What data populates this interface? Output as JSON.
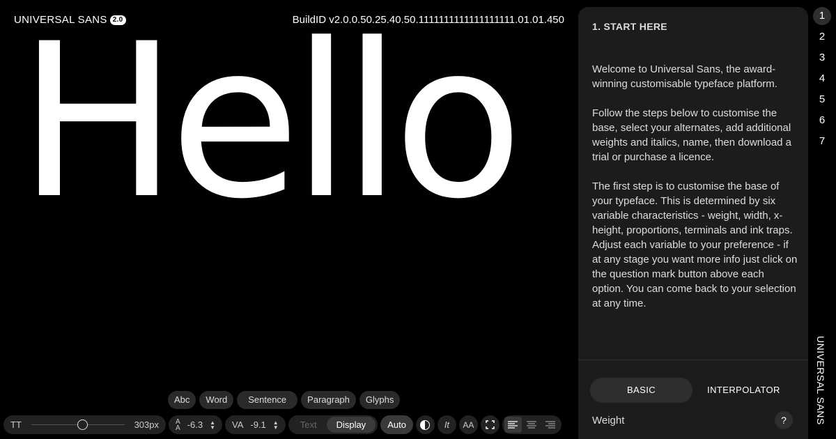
{
  "header": {
    "brand": "UNIVERSAL SANS",
    "version_badge": "2.0",
    "build_id": "BuildID v2.0.0.50.25.40.50.1111111111111111111.01.01.450"
  },
  "preview": {
    "text": "Hello"
  },
  "modes": [
    "Abc",
    "Word",
    "Sentence",
    "Paragraph",
    "Glyphs"
  ],
  "toolbar": {
    "size_label": "TT",
    "size_value": "303px",
    "size_slider_fraction": 0.55,
    "leading_label_top": "A",
    "leading_label_bottom": "A",
    "leading_value": "-6.3",
    "tracking_label": "VA",
    "tracking_value": "-9.1",
    "style_text": "Text",
    "style_display": "Display",
    "auto": "Auto",
    "italic": "It",
    "case": "AA"
  },
  "panel": {
    "title": "1. START HERE",
    "paragraphs": [
      "Welcome to Universal Sans, the award-winning customisable typeface platform.",
      "Follow the steps below to customise the base, select your alternates, add additional weights and italics, name, then download a trial or purchase a licence.",
      "The first step is to customise the base of your typeface. This is determined by six variable characteristics - weight, width, x-height, proportions, terminals and ink traps. Adjust each variable to your preference - if at any stage you want more info just click on the question mark button above each option. You can come back to your selection at any time."
    ],
    "tabs": [
      "BASIC",
      "INTERPOLATOR"
    ],
    "weight_label": "Weight",
    "help": "?"
  },
  "steps": [
    "1",
    "2",
    "3",
    "4",
    "5",
    "6",
    "7"
  ],
  "side_brand": "UNIVERSAL SANS",
  "colors": {
    "background": "#000000",
    "panel": "#1c1c1c",
    "text": "#ffffff"
  }
}
